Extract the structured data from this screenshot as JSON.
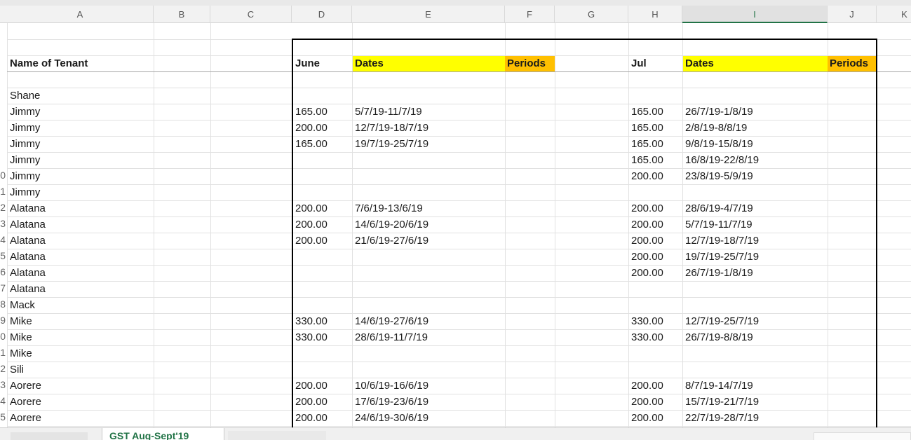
{
  "columns": [
    "A",
    "B",
    "C",
    "D",
    "E",
    "F",
    "G",
    "H",
    "I",
    "J",
    "K"
  ],
  "row_numbers": [
    "0",
    "1",
    "2",
    "3",
    "4",
    "5",
    "6",
    "7",
    "8",
    "9",
    "0",
    "1",
    "2",
    "3",
    "4",
    "5"
  ],
  "header_row": {
    "a": "Name of Tenant",
    "d": "June",
    "e": "Dates",
    "f": "Periods",
    "h": "Jul",
    "i": "Dates",
    "j": "Periods"
  },
  "rows": [
    {
      "name": "Shane",
      "jun_amt": "",
      "jun_dates": "",
      "jul_amt": "",
      "jul_dates": ""
    },
    {
      "name": "Jimmy",
      "jun_amt": "165.00",
      "jun_dates": "5/7/19-11/7/19",
      "jul_amt": "165.00",
      "jul_dates": "26/7/19-1/8/19"
    },
    {
      "name": "Jimmy",
      "jun_amt": "200.00",
      "jun_dates": "12/7/19-18/7/19",
      "jul_amt": "165.00",
      "jul_dates": "2/8/19-8/8/19"
    },
    {
      "name": "Jimmy",
      "jun_amt": "165.00",
      "jun_dates": "19/7/19-25/7/19",
      "jul_amt": "165.00",
      "jul_dates": "9/8/19-15/8/19"
    },
    {
      "name": "Jimmy",
      "jun_amt": "",
      "jun_dates": "",
      "jul_amt": "165.00",
      "jul_dates": "16/8/19-22/8/19"
    },
    {
      "name": "Jimmy",
      "jun_amt": "",
      "jun_dates": "",
      "jul_amt": "200.00",
      "jul_dates": "23/8/19-5/9/19"
    },
    {
      "name": "Jimmy",
      "jun_amt": "",
      "jun_dates": "",
      "jul_amt": "",
      "jul_dates": ""
    },
    {
      "name": "Alatana",
      "jun_amt": "200.00",
      "jun_dates": "7/6/19-13/6/19",
      "jul_amt": "200.00",
      "jul_dates": "28/6/19-4/7/19"
    },
    {
      "name": "Alatana",
      "jun_amt": "200.00",
      "jun_dates": "14/6/19-20/6/19",
      "jul_amt": "200.00",
      "jul_dates": "5/7/19-11/7/19"
    },
    {
      "name": "Alatana",
      "jun_amt": "200.00",
      "jun_dates": "21/6/19-27/6/19",
      "jul_amt": "200.00",
      "jul_dates": "12/7/19-18/7/19"
    },
    {
      "name": "Alatana",
      "jun_amt": "",
      "jun_dates": "",
      "jul_amt": "200.00",
      "jul_dates": "19/7/19-25/7/19"
    },
    {
      "name": "Alatana",
      "jun_amt": "",
      "jun_dates": "",
      "jul_amt": "200.00",
      "jul_dates": "26/7/19-1/8/19"
    },
    {
      "name": "Alatana",
      "jun_amt": "",
      "jun_dates": "",
      "jul_amt": "",
      "jul_dates": ""
    },
    {
      "name": "Mack",
      "jun_amt": "",
      "jun_dates": "",
      "jul_amt": "",
      "jul_dates": ""
    },
    {
      "name": "Mike",
      "jun_amt": "330.00",
      "jun_dates": "14/6/19-27/6/19",
      "jul_amt": "330.00",
      "jul_dates": "12/7/19-25/7/19"
    },
    {
      "name": "Mike",
      "jun_amt": "330.00",
      "jun_dates": "28/6/19-11/7/19",
      "jul_amt": "330.00",
      "jul_dates": "26/7/19-8/8/19"
    },
    {
      "name": "Mike",
      "jun_amt": "",
      "jun_dates": "",
      "jul_amt": "",
      "jul_dates": ""
    },
    {
      "name": "Sili",
      "jun_amt": "",
      "jun_dates": "",
      "jul_amt": "",
      "jul_dates": ""
    },
    {
      "name": "Aorere",
      "jun_amt": "200.00",
      "jun_dates": "10/6/19-16/6/19",
      "jul_amt": "200.00",
      "jul_dates": "8/7/19-14/7/19"
    },
    {
      "name": "Aorere",
      "jun_amt": "200.00",
      "jun_dates": "17/6/19-23/6/19",
      "jul_amt": "200.00",
      "jul_dates": "15/7/19-21/7/19"
    },
    {
      "name": "Aorere",
      "jun_amt": "200.00",
      "jun_dates": "24/6/19-30/6/19",
      "jul_amt": "200.00",
      "jul_dates": "22/7/19-28/7/19"
    }
  ],
  "sheet_tab": "GST Aug-Sept'19",
  "colors": {
    "yellow": "#ffff00",
    "orange": "#ffc000",
    "accent": "#217346"
  }
}
